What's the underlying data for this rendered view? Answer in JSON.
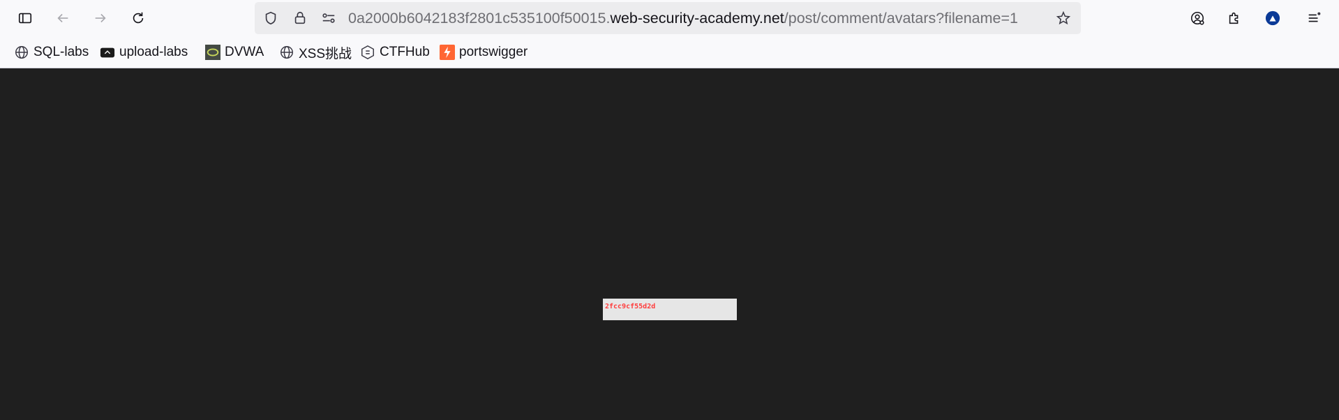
{
  "browser": {
    "url_prefix": "0a2000b6042183f2801c535100f50015.",
    "url_domain": "web-security-academy.net",
    "url_suffix": "/post/comment/avatars?filename=1",
    "icons": {
      "sidebar": "sidebar-icon",
      "back": "arrow-left-icon",
      "forward": "arrow-right-icon",
      "reload": "reload-icon",
      "shield": "shield-icon",
      "lock": "lock-icon",
      "permissions": "permissions-icon",
      "star": "star-icon",
      "account": "account-icon",
      "extensions": "puzzle-icon",
      "profile": "profile-icon",
      "menu": "menu-icon"
    }
  },
  "bookmarks": [
    {
      "label": "SQL-labs",
      "icon": "globe-icon"
    },
    {
      "label": "upload-labs",
      "icon": "upload-labs-icon"
    },
    {
      "label": "DVWA",
      "icon": "dvwa-icon"
    },
    {
      "label": "XSS挑战",
      "icon": "globe-icon"
    },
    {
      "label": "CTFHub",
      "icon": "ctfhub-icon"
    },
    {
      "label": "portswigger",
      "icon": "portswigger-icon"
    }
  ],
  "page": {
    "image_text": "2fcc9cf55d2d",
    "background_color": "#1f1f1f",
    "text_color": "#ff3b3b"
  }
}
